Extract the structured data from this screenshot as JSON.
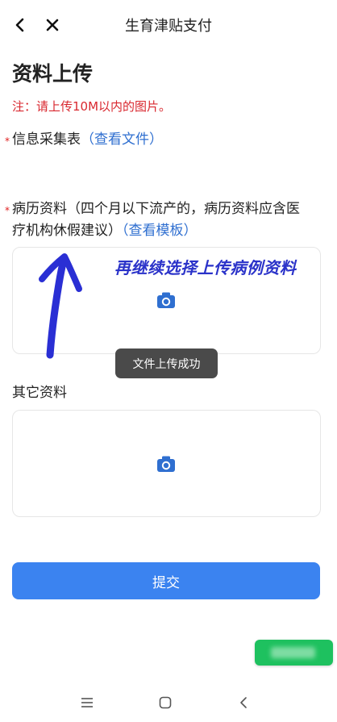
{
  "header": {
    "title": "生育津贴支付",
    "back_icon": "chevron-left-icon",
    "close_icon": "close-icon"
  },
  "page": {
    "title": "资料上传",
    "note": "注：请上传10M以内的图片。"
  },
  "fields": [
    {
      "required": "*",
      "label": "信息采集表",
      "link": "（查看文件）"
    },
    {
      "required": "*",
      "label_line1": "病历资料（四个月以下流产的，病历资料应含医",
      "label_line2": "疗机构休假建议）",
      "link": "（查看模板）"
    },
    {
      "label": "其它资料"
    }
  ],
  "annotation": {
    "text": "再继续选择上传病例资料"
  },
  "toast": {
    "text": "文件上传成功"
  },
  "submit": {
    "label": "提交"
  },
  "colors": {
    "accent": "#3b83f0",
    "link": "#2f6fd0",
    "warning": "#d9282f",
    "annotation": "#2a32c9",
    "float_button": "#1ec15f"
  }
}
